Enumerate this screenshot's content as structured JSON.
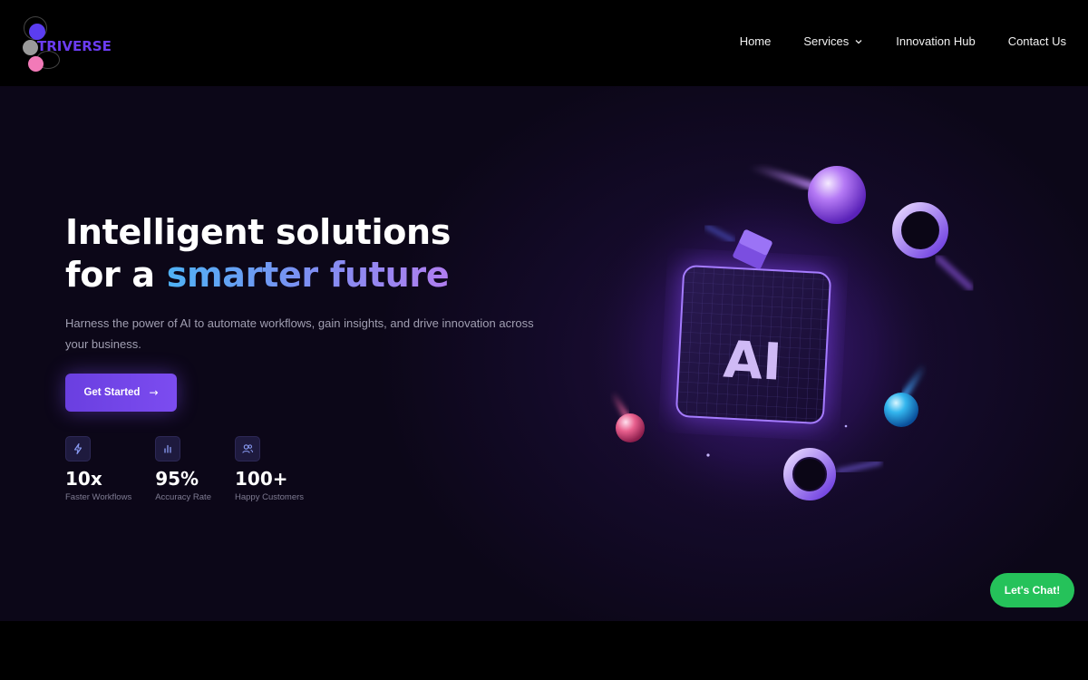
{
  "brand": {
    "name": "TRIVERSE"
  },
  "nav": {
    "items": [
      {
        "label": "Home"
      },
      {
        "label": "Services",
        "icon": "chevron-down-icon"
      },
      {
        "label": "Innovation Hub"
      },
      {
        "label": "Contact Us"
      }
    ]
  },
  "hero": {
    "headline_line1": "Intelligent solutions",
    "headline_line2_prefix": "for a ",
    "headline_line2_highlight": "smarter future",
    "subtext": "Harness the power of AI to automate workflows, gain insights, and drive innovation across your business.",
    "cta_label": "Get Started",
    "cta_arrow": "→",
    "illustration_label": "AI"
  },
  "stats": [
    {
      "icon": "lightning-icon",
      "value": "10x",
      "label": "Faster Workflows"
    },
    {
      "icon": "bar-chart-icon",
      "value": "95%",
      "label": "Accuracy Rate"
    },
    {
      "icon": "users-icon",
      "value": "100+",
      "label": "Happy Customers"
    }
  ],
  "chat": {
    "label": "Let's Chat!"
  },
  "colors": {
    "accent": "#7c4cf0",
    "brand": "#6b3cf2",
    "chat": "#25c25a",
    "background": "#0c0718"
  }
}
